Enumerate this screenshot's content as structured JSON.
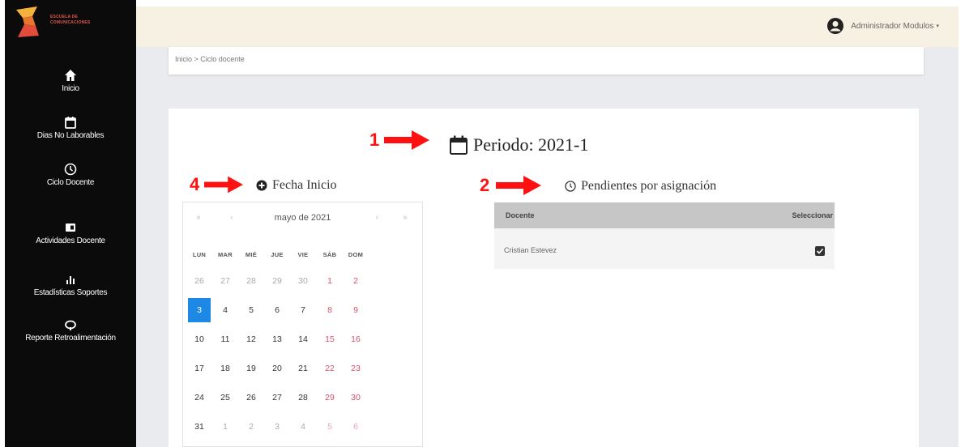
{
  "app": {
    "logo_text": "ESCUELA DE COMUNICACIONES"
  },
  "sidebar": {
    "items": [
      {
        "label": "Inicio",
        "icon": "home-icon"
      },
      {
        "label": "Dias No Laborables",
        "icon": "calendar-icon"
      },
      {
        "label": "Ciclo Docente",
        "icon": "clock-icon"
      },
      {
        "label": "Actividades Docente",
        "icon": "id-card-icon"
      },
      {
        "label": "Estadísticas Soportes",
        "icon": "bar-chart-icon"
      },
      {
        "label": "Reporte Retroalimentación",
        "icon": "feedback-icon"
      }
    ]
  },
  "header": {
    "user_name": "Administrador Modulos",
    "caret": "▾"
  },
  "breadcrumb": {
    "text": "Inicio > Ciclo docente"
  },
  "main": {
    "periodo_title": "Periodo: 2021-1",
    "fecha_inicio_title": "Fecha Inicio",
    "pendientes_title": "Pendientes por asignación"
  },
  "annotations": [
    "1",
    "2",
    "4"
  ],
  "calendar": {
    "month_label": "mayo de 2021",
    "prev_year": "«",
    "prev_month": "‹",
    "next_month": "›",
    "next_year": "»",
    "weekdays": [
      "LUN",
      "MAR",
      "MIÉ",
      "JUE",
      "VIE",
      "SÁB",
      "DOM"
    ],
    "weeks": [
      [
        "26",
        "27",
        "28",
        "29",
        "30",
        "1",
        "2"
      ],
      [
        "3",
        "4",
        "5",
        "6",
        "7",
        "8",
        "9"
      ],
      [
        "10",
        "11",
        "12",
        "13",
        "14",
        "15",
        "16"
      ],
      [
        "17",
        "18",
        "19",
        "20",
        "21",
        "22",
        "23"
      ],
      [
        "24",
        "25",
        "26",
        "27",
        "28",
        "29",
        "30"
      ],
      [
        "31",
        "1",
        "2",
        "3",
        "4",
        "5",
        "6"
      ]
    ],
    "selected_day": "3",
    "accent_color": "#1e88e5"
  },
  "table": {
    "headers": {
      "docente": "Docente",
      "seleccionar": "Seleccionar"
    },
    "rows": [
      {
        "docente": "Cristian Estevez",
        "seleccionar": true
      }
    ]
  },
  "colors": {
    "sidebar_bg": "#0b0b0b",
    "topbar_bg": "#f6f1e2",
    "annotation_red": "#f11",
    "weekend_red": "#d4546b"
  }
}
